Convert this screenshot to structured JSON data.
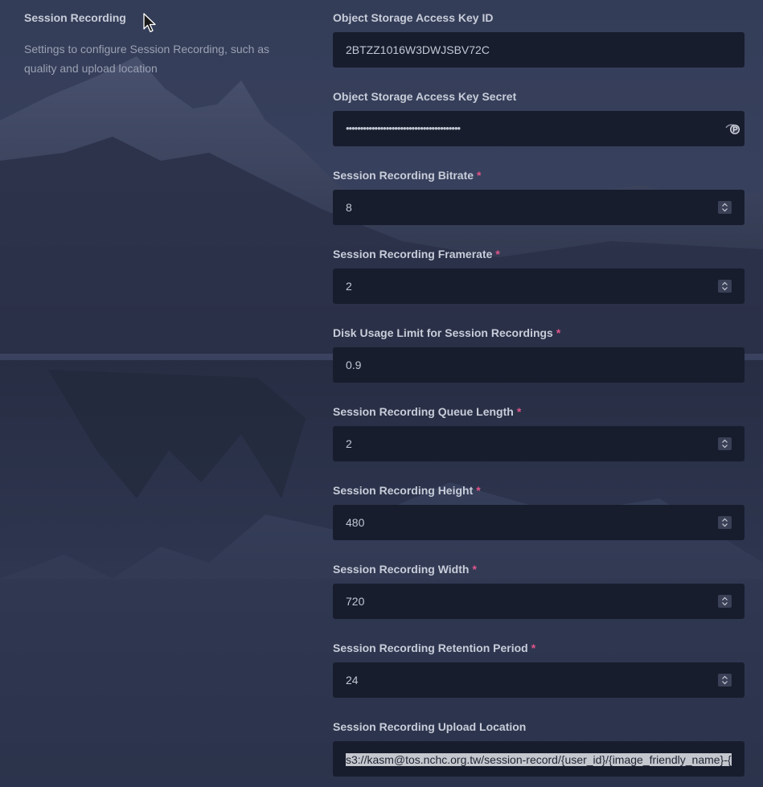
{
  "section": {
    "title": "Session Recording",
    "description": "Settings to configure Session Recording, such as quality and upload location"
  },
  "fields": {
    "access_key_id": {
      "label": "Object Storage Access Key ID",
      "value": "2BTZZ1016W3DWJSBV72C"
    },
    "access_key_secret": {
      "label": "Object Storage Access Key Secret",
      "masked_value": "••••••••••••••••••••••••••••••••••••••••"
    },
    "bitrate": {
      "label": "Session Recording Bitrate",
      "value": "8",
      "required_mark": "*"
    },
    "framerate": {
      "label": "Session Recording Framerate",
      "value": "2",
      "required_mark": "*"
    },
    "disk_usage_limit": {
      "label": "Disk Usage Limit for Session Recordings",
      "value": "0.9",
      "required_mark": "*"
    },
    "queue_length": {
      "label": "Session Recording Queue Length",
      "value": "2",
      "required_mark": "*"
    },
    "height": {
      "label": "Session Recording Height",
      "value": "480",
      "required_mark": "*"
    },
    "width": {
      "label": "Session Recording Width",
      "value": "720",
      "required_mark": "*"
    },
    "retention_period": {
      "label": "Session Recording Retention Period",
      "value": "24",
      "required_mark": "*"
    },
    "upload_location": {
      "label": "Session Recording Upload Location",
      "value": "s3://kasm@tos.nchc.org.tw/session-record/{user_id}/{image_friendly_name}-{"
    }
  },
  "icons": {
    "stepper": "spin-stepper-icon",
    "password_toggle": "eye-toggle-icon",
    "cursor": "mouse-pointer-icon"
  },
  "colors": {
    "background": "#2f3750",
    "input_background": "#181d2e",
    "label": "#c8cdd9",
    "required": "#e0558a",
    "selection": "#c4c7cd"
  }
}
